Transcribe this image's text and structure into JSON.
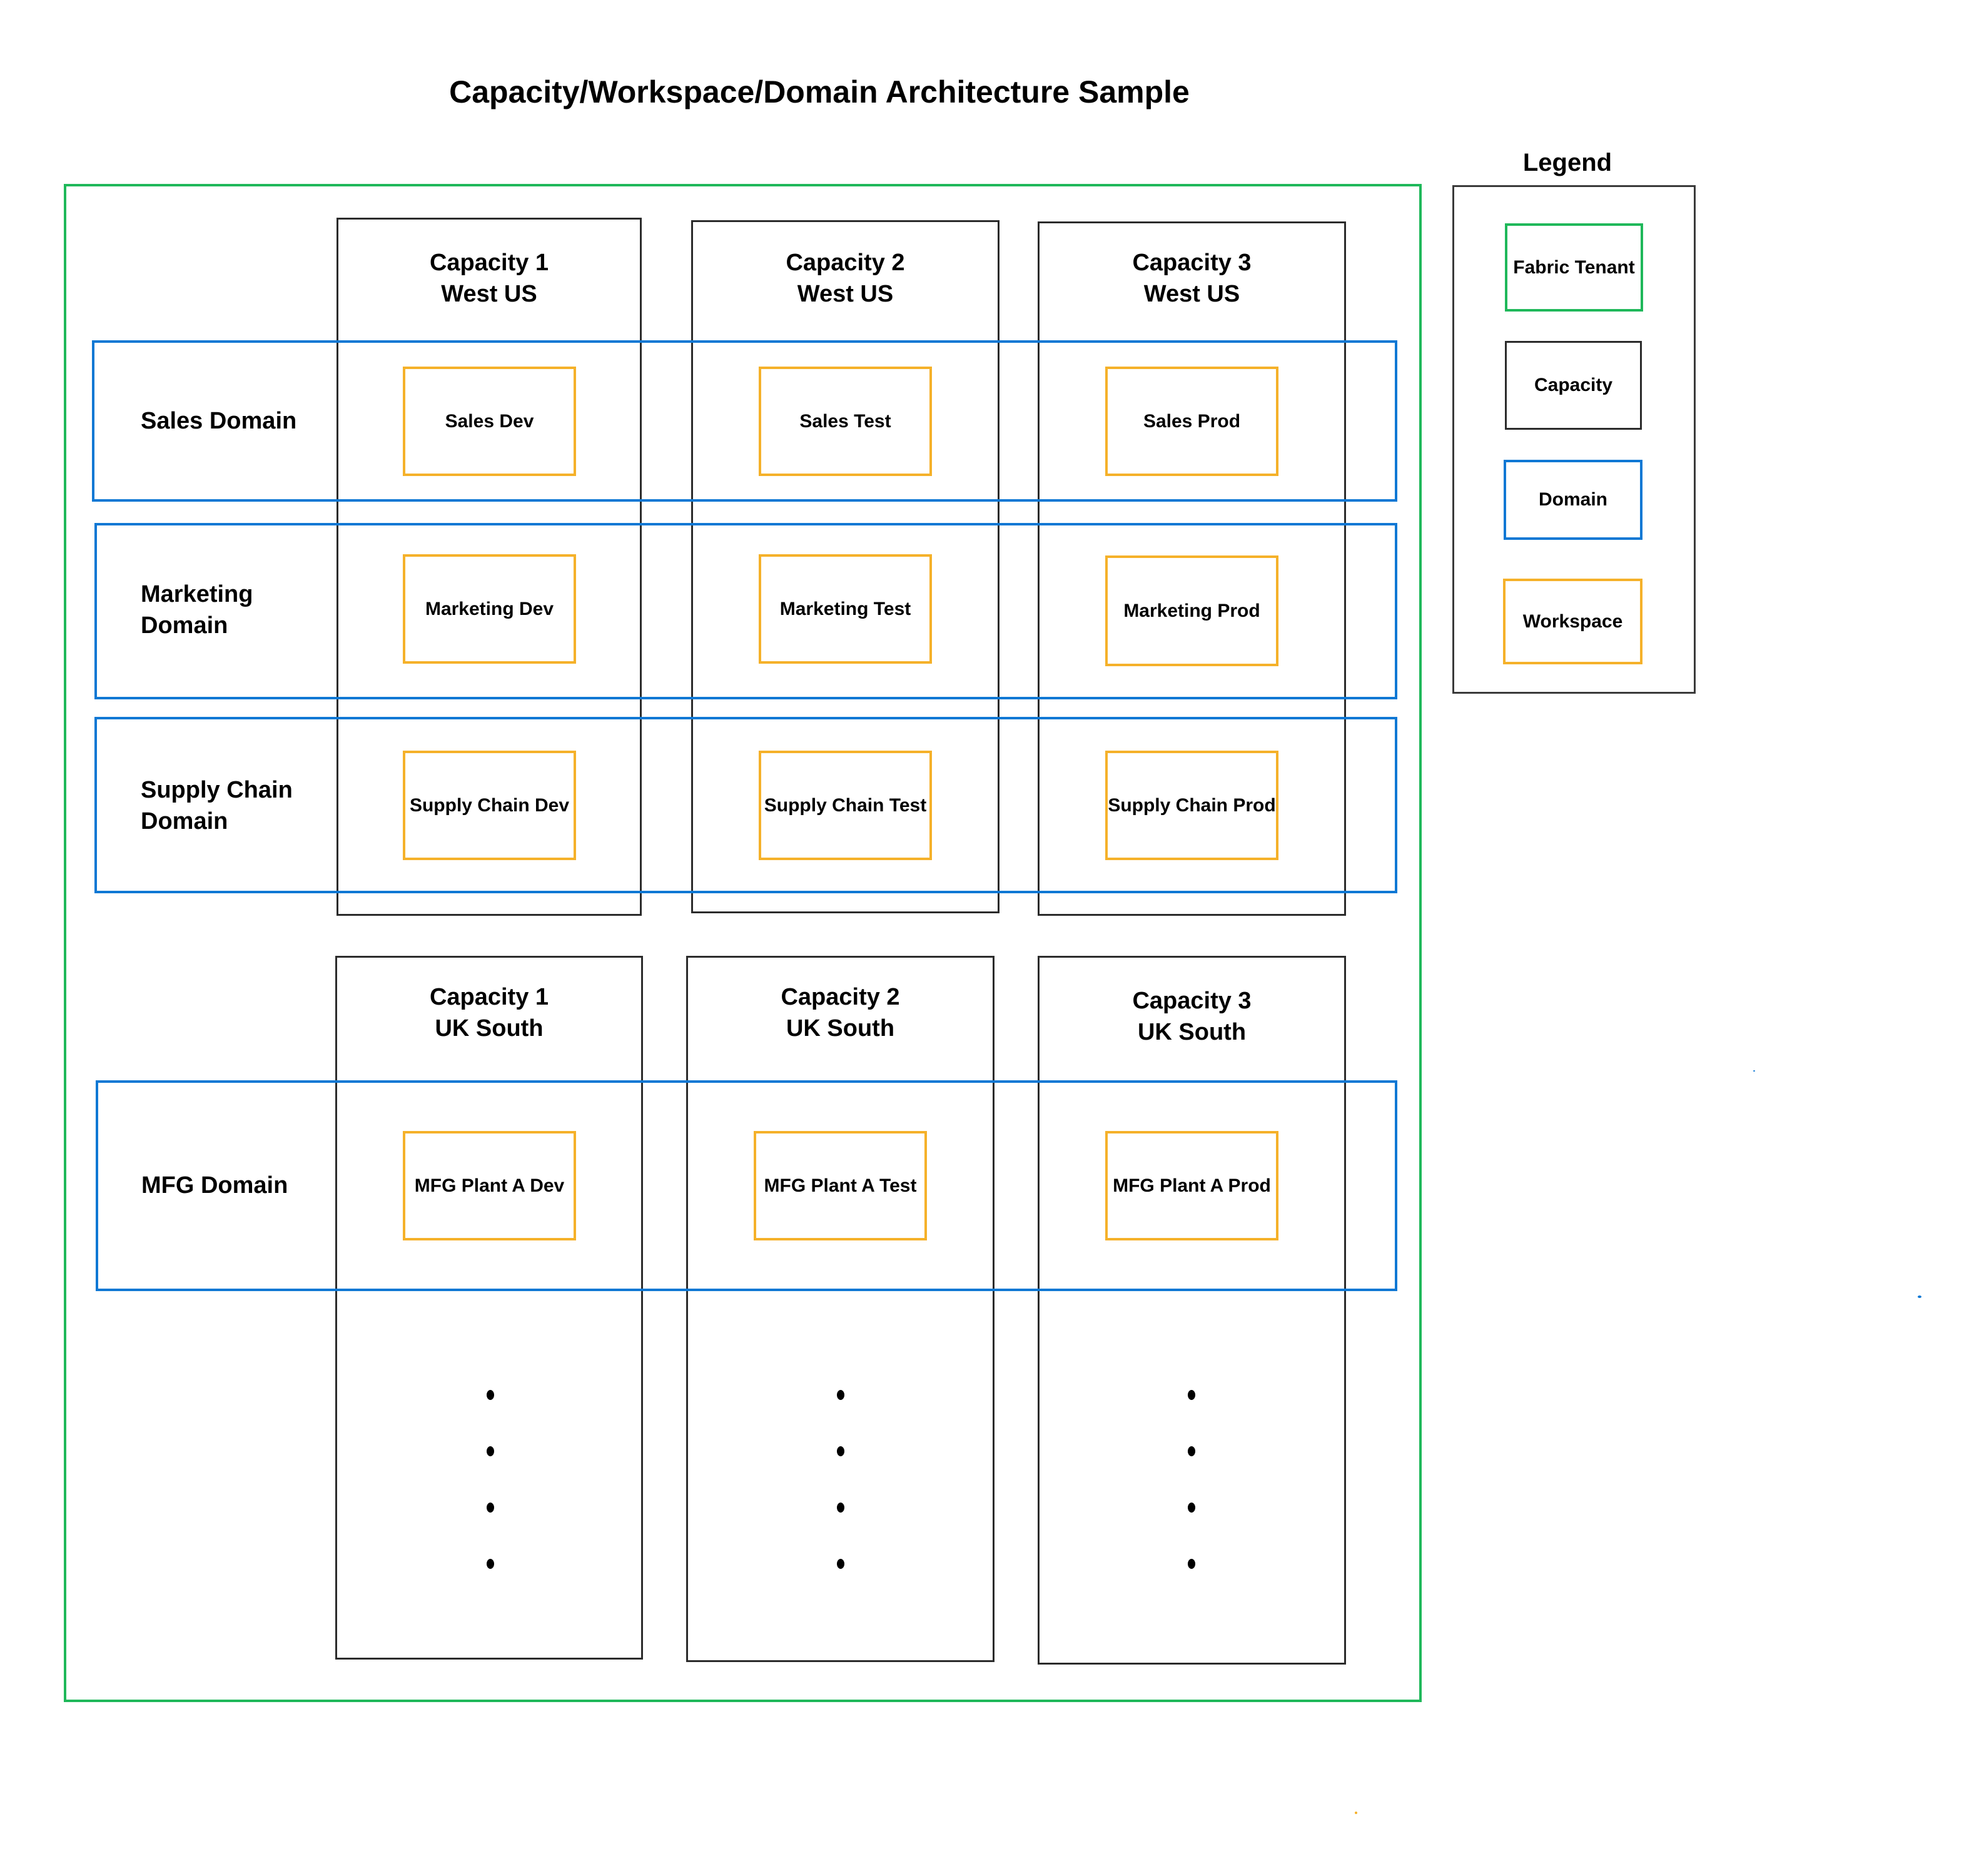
{
  "title": "Capacity/Workspace/Domain Architecture Sample",
  "colors": {
    "fabric_tenant": "#1fb85a",
    "capacity": "#2b2b2b",
    "domain": "#0f78d4",
    "workspace": "#f5b12a"
  },
  "legend": {
    "title": "Legend",
    "items": [
      {
        "label": "Fabric Tenant",
        "kind": "fabric_tenant"
      },
      {
        "label": "Capacity",
        "kind": "capacity"
      },
      {
        "label": "Domain",
        "kind": "domain"
      },
      {
        "label": "Workspace",
        "kind": "workspace"
      }
    ]
  },
  "regions": [
    {
      "name": "West US",
      "capacities": [
        {
          "name": "Capacity 1",
          "region": "West US"
        },
        {
          "name": "Capacity 2",
          "region": "West US"
        },
        {
          "name": "Capacity 3",
          "region": "West US"
        }
      ],
      "domains": [
        {
          "name": "Sales Domain",
          "workspaces": [
            "Sales Dev",
            "Sales Test",
            "Sales Prod"
          ]
        },
        {
          "name": "Marketing Domain",
          "workspaces": [
            "Marketing Dev",
            "Marketing Test",
            "Marketing Prod"
          ]
        },
        {
          "name": "Supply Chain Domain",
          "workspaces": [
            "Supply Chain Dev",
            "Supply Chain Test",
            "Supply Chain Prod"
          ]
        }
      ]
    },
    {
      "name": "UK South",
      "capacities": [
        {
          "name": "Capacity 1",
          "region": "UK South"
        },
        {
          "name": "Capacity 2",
          "region": "UK South"
        },
        {
          "name": "Capacity 3",
          "region": "UK South"
        }
      ],
      "domains": [
        {
          "name": "MFG Domain",
          "workspaces": [
            "MFG Plant A Dev",
            "MFG Plant A Test",
            "MFG Plant A Prod"
          ]
        }
      ],
      "continuation": "more"
    }
  ]
}
